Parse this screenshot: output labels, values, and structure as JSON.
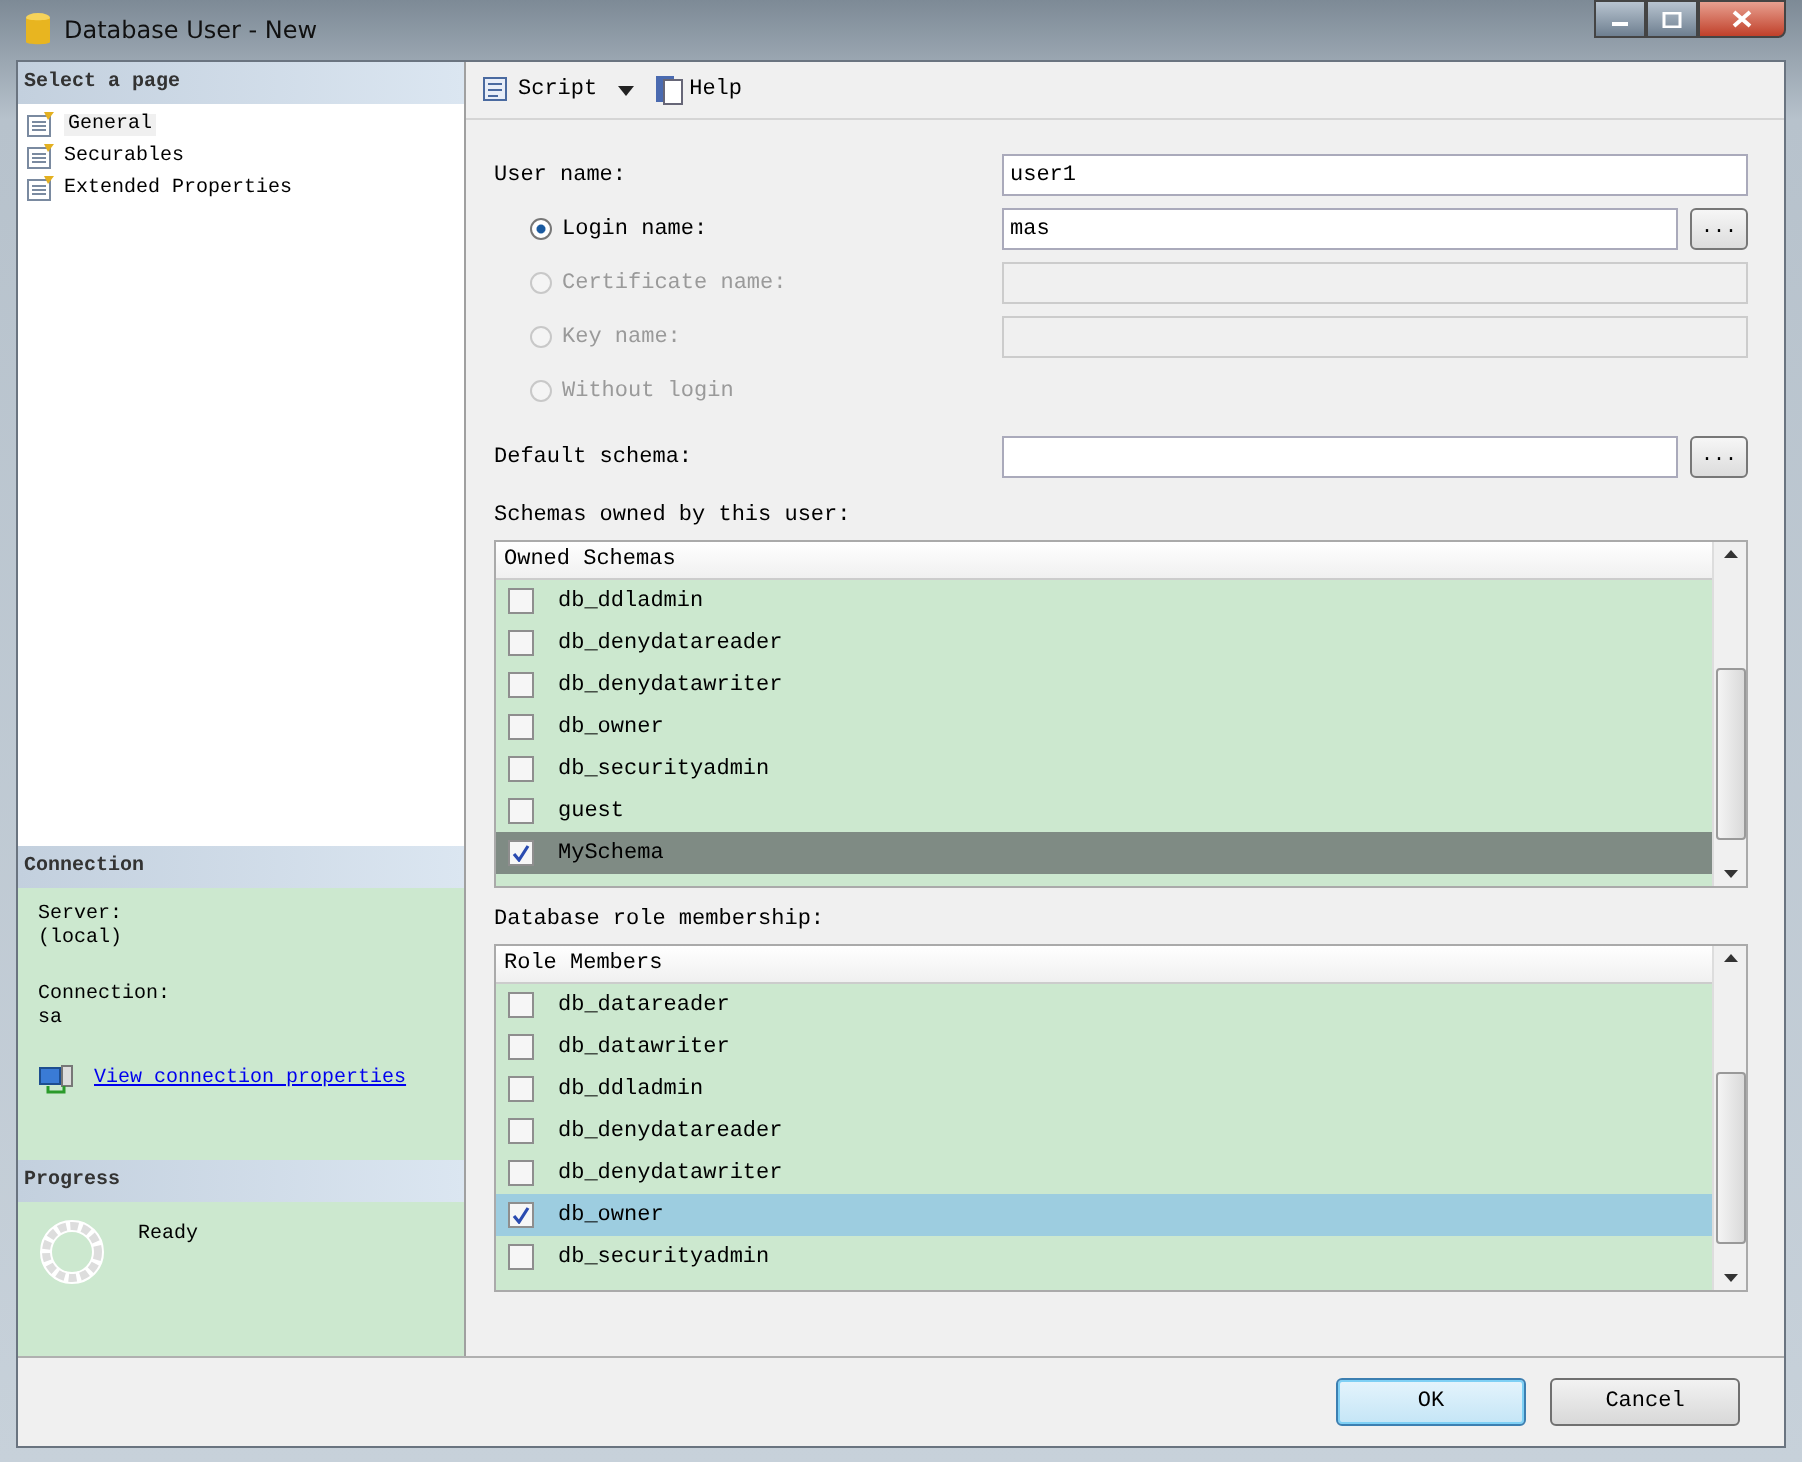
{
  "window": {
    "title": "Database User - New"
  },
  "sidebar": {
    "header": "Select a page",
    "items": [
      {
        "label": "General",
        "selected": true
      },
      {
        "label": "Securables",
        "selected": false
      },
      {
        "label": "Extended Properties",
        "selected": false
      }
    ]
  },
  "connection": {
    "header": "Connection",
    "server_label": "Server:",
    "server": "(local)",
    "connection_label": "Connection:",
    "connection": "sa",
    "link": "View connection properties"
  },
  "progress": {
    "header": "Progress",
    "status": "Ready"
  },
  "toolbar": {
    "script": "Script",
    "help": "Help"
  },
  "form": {
    "user_name_label": "User name:",
    "user_name": "user1",
    "login_options": [
      {
        "label": "Login name:",
        "selected": true,
        "disabled": false,
        "value": "mas",
        "kind": "field_browse"
      },
      {
        "label": "Certificate name:",
        "selected": false,
        "disabled": true,
        "kind": "field"
      },
      {
        "label": "Key name:",
        "selected": false,
        "disabled": true,
        "kind": "field"
      },
      {
        "label": "Without login",
        "selected": false,
        "disabled": true,
        "kind": "plain"
      }
    ],
    "browse": "...",
    "default_schema_label": "Default schema:",
    "default_schema_browse": "..."
  },
  "schemas": {
    "label": "Schemas owned by this user:",
    "column": "Owned Schemas",
    "rows": [
      {
        "name": "db_ddladmin",
        "checked": false,
        "selected": false
      },
      {
        "name": "db_denydatareader",
        "checked": false,
        "selected": false
      },
      {
        "name": "db_denydatawriter",
        "checked": false,
        "selected": false
      },
      {
        "name": "db_owner",
        "checked": false,
        "selected": false
      },
      {
        "name": "db_securityadmin",
        "checked": false,
        "selected": false
      },
      {
        "name": "guest",
        "checked": false,
        "selected": false
      },
      {
        "name": "MySchema",
        "checked": true,
        "selected": true
      }
    ]
  },
  "roles": {
    "label": "Database role membership:",
    "column": "Role Members",
    "rows": [
      {
        "name": "db_datareader",
        "checked": false,
        "selected": false
      },
      {
        "name": "db_datawriter",
        "checked": false,
        "selected": false
      },
      {
        "name": "db_ddladmin",
        "checked": false,
        "selected": false
      },
      {
        "name": "db_denydatareader",
        "checked": false,
        "selected": false
      },
      {
        "name": "db_denydatawriter",
        "checked": false,
        "selected": false
      },
      {
        "name": "db_owner",
        "checked": true,
        "selected": true
      },
      {
        "name": "db_securityadmin",
        "checked": false,
        "selected": false
      }
    ]
  },
  "buttons": [
    {
      "label": "OK",
      "default": true
    },
    {
      "label": "Cancel",
      "default": false
    }
  ]
}
